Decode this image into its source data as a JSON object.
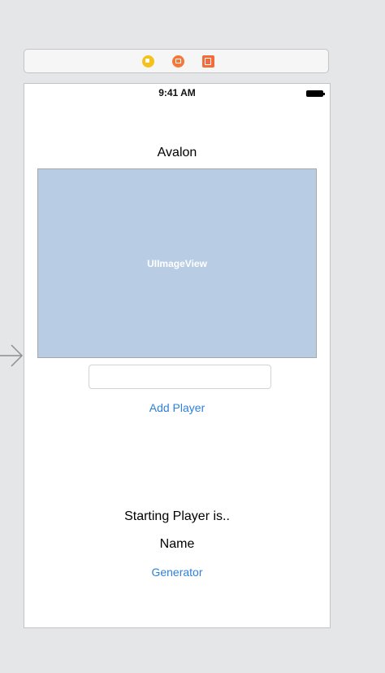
{
  "scene_dock": {
    "icons": [
      "view-controller-icon",
      "first-responder-icon",
      "exit-icon"
    ]
  },
  "status_bar": {
    "time": "9:41 AM"
  },
  "content": {
    "title": "Avalon",
    "image_view_label": "UIImageView",
    "player_field": {
      "value": "",
      "placeholder": ""
    },
    "add_button": "Add Player",
    "starting_label": "Starting Player is..",
    "name_label": "Name",
    "generator_button": "Generator"
  },
  "colors": {
    "canvas": "#e5e6e8",
    "image_view_fill": "#b8cde4",
    "button_tint": "#2f80d8"
  }
}
